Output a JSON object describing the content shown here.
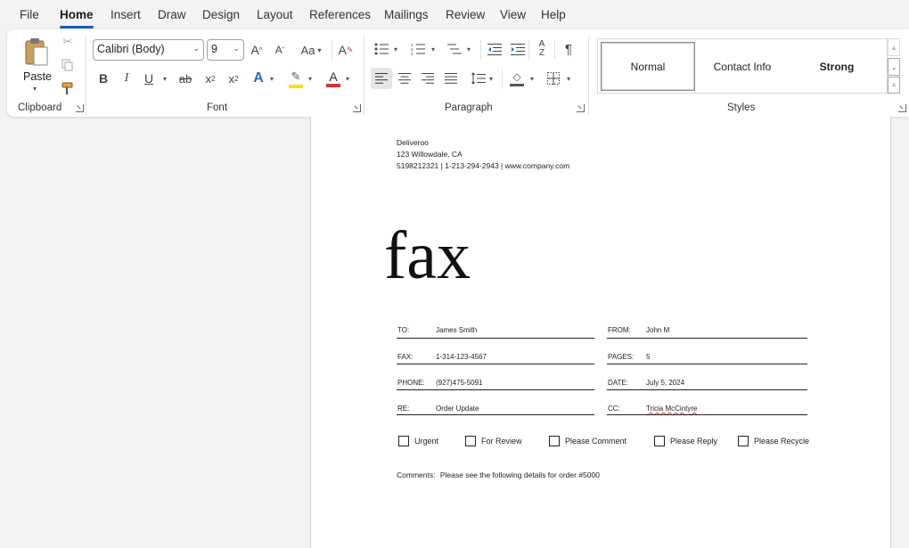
{
  "menu": {
    "tabs": [
      "File",
      "Home",
      "Insert",
      "Draw",
      "Design",
      "Layout",
      "References",
      "Mailings",
      "Review",
      "View",
      "Help"
    ],
    "active": "Home"
  },
  "ribbon": {
    "clipboard": {
      "label": "Clipboard",
      "paste_label": "Paste"
    },
    "font": {
      "label": "Font",
      "name": "Calibri (Body)",
      "size": "9",
      "change_case_label": "Aa"
    },
    "paragraph": {
      "label": "Paragraph"
    },
    "styles": {
      "label": "Styles",
      "items": [
        "Normal",
        "Contact Info",
        "Strong"
      ],
      "selected": "Normal"
    }
  },
  "document": {
    "sender": {
      "company": "Deliveroo",
      "address": "123 Willowdale, CA",
      "contact": "5198212321 | 1-213-294-2943 | www.company.com"
    },
    "title": "fax",
    "fields": [
      {
        "left_label": "TO:",
        "left_value": "James Smith",
        "right_label": "FROM:",
        "right_value": "John M"
      },
      {
        "left_label": "FAX:",
        "left_value": "1-314-123-4567",
        "right_label": "PAGES:",
        "right_value": "5"
      },
      {
        "left_label": "PHONE:",
        "left_value": "(927)475-5091",
        "right_label": "DATE:",
        "right_value": "July 5, 2024"
      },
      {
        "left_label": "RE:",
        "left_value": "Order Update",
        "right_label": "CC:",
        "right_value": "Tricia McCintyre"
      }
    ],
    "checkboxes": [
      "Urgent",
      "For Review",
      "Please Comment",
      "Please Reply",
      "Please Recycle"
    ],
    "comments_label": "Comments:",
    "comments_text": "Please see the following details for order #5000"
  }
}
